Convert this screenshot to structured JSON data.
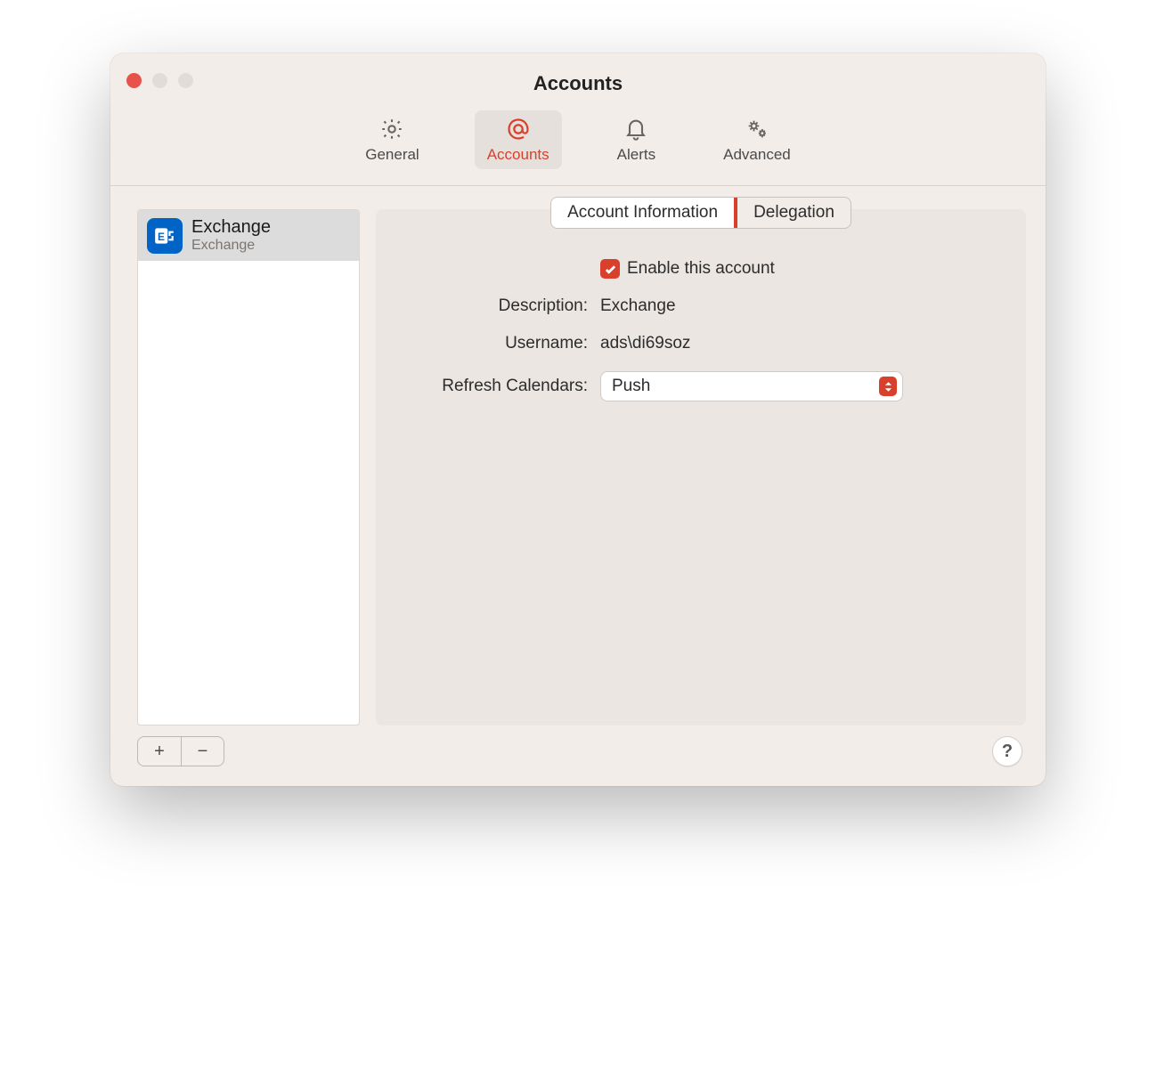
{
  "window": {
    "title": "Accounts"
  },
  "toolbar": {
    "general": "General",
    "accounts": "Accounts",
    "alerts": "Alerts",
    "advanced": "Advanced"
  },
  "sidebar": {
    "account": {
      "name": "Exchange",
      "sub": "Exchange"
    }
  },
  "tabs": {
    "info": "Account Information",
    "delegation": "Delegation"
  },
  "form": {
    "enable_label": "Enable this account",
    "description_label": "Description:",
    "description_value": "Exchange",
    "username_label": "Username:",
    "username_value": "ads\\di69soz",
    "refresh_label": "Refresh Calendars:",
    "refresh_value": "Push"
  },
  "buttons": {
    "add": "+",
    "remove": "−",
    "help": "?"
  }
}
